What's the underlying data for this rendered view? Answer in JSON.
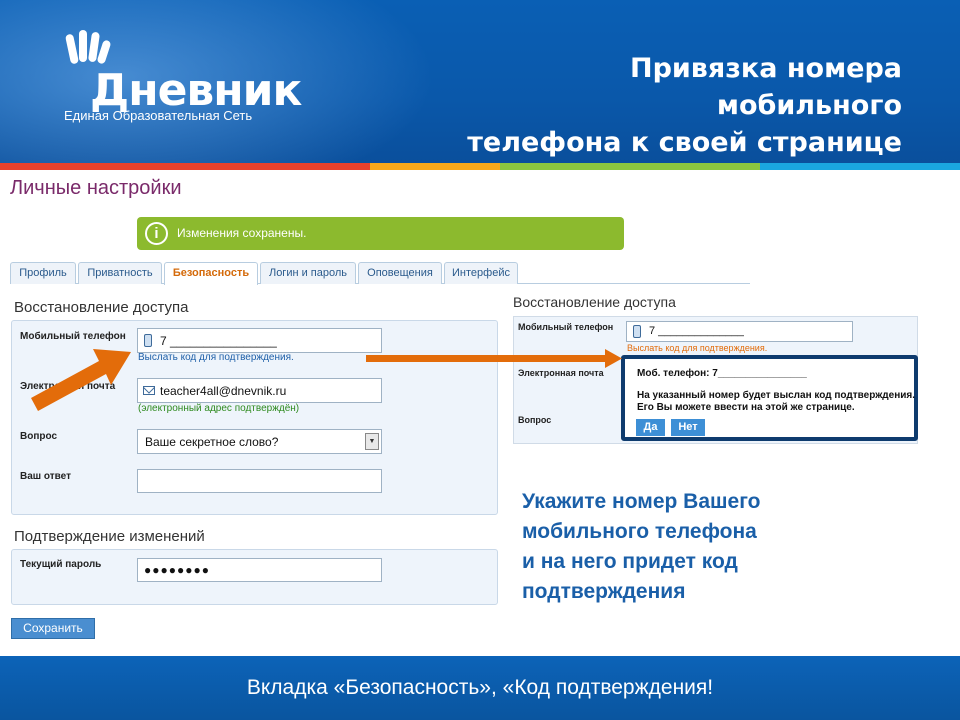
{
  "header": {
    "logo_word": "Дневник",
    "logo_subtitle": "Единая Образовательная Сеть",
    "title_line1": "Привязка номера мобильного",
    "title_line2": "телефона к своей странице"
  },
  "colors": {
    "header_blue": "#0a58aa",
    "stripe": [
      "#e8412c",
      "#f7a81b",
      "#8cc63f",
      "#1aa6e0"
    ],
    "accent_orange": "#e36c0a",
    "notice_green": "#8cba2e"
  },
  "settings": {
    "page_title": "Личные настройки",
    "notice": "Изменения сохранены.",
    "tabs": [
      {
        "label": "Профиль",
        "active": false
      },
      {
        "label": "Приватность",
        "active": false
      },
      {
        "label": "Безопасность",
        "active": true
      },
      {
        "label": "Логин и пароль",
        "active": false
      },
      {
        "label": "Оповещения",
        "active": false
      },
      {
        "label": "Интерфейс",
        "active": false
      }
    ],
    "recovery": {
      "title": "Восстановление доступа",
      "phone_label": "Мобильный телефон",
      "phone_value": "7 ________________",
      "phone_hint": "Выслать код для подтверждения.",
      "email_label": "Электронная почта",
      "email_value": "teacher4all@dnevnik.ru",
      "email_hint": "(электронный адрес подтверждён)",
      "question_label": "Вопрос",
      "question_value": "Ваше секретное слово?",
      "answer_label": "Ваш ответ",
      "answer_value": ""
    },
    "confirm": {
      "title": "Подтверждение изменений",
      "password_label": "Текущий пароль",
      "password_value": "●●●●●●●●"
    },
    "save_button": "Сохранить"
  },
  "mini": {
    "title": "Восстановление доступа",
    "phone_label": "Мобильный телефон",
    "phone_value": "7 ______________",
    "phone_hint": "Выслать код для подтверждения.",
    "email_label": "Электронная почта",
    "question_label": "Вопрос",
    "dialog": {
      "line1": "Моб. телефон: 7________________",
      "line2": "На указанный номер будет выслан код подтверждения.",
      "line3": "Его Вы можете ввести на этой же странице.",
      "yes": "Да",
      "no": "Нет"
    }
  },
  "callout": {
    "line1": "Укажите номер Вашего",
    "line2": "мобильного телефона",
    "line3": "и на него придет код",
    "line4": "подтверждения"
  },
  "footer": {
    "text": "Вкладка «Безопасность», «Код подтверждения!"
  }
}
